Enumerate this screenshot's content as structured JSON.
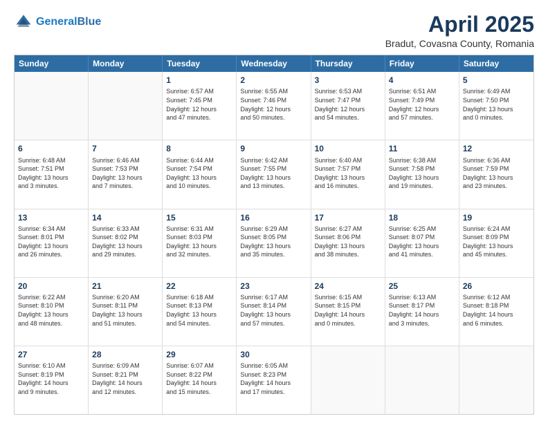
{
  "header": {
    "logo_line1": "General",
    "logo_line2": "Blue",
    "title": "April 2025",
    "subtitle": "Bradut, Covasna County, Romania"
  },
  "days": [
    "Sunday",
    "Monday",
    "Tuesday",
    "Wednesday",
    "Thursday",
    "Friday",
    "Saturday"
  ],
  "rows": [
    [
      {
        "day": "",
        "lines": []
      },
      {
        "day": "",
        "lines": []
      },
      {
        "day": "1",
        "lines": [
          "Sunrise: 6:57 AM",
          "Sunset: 7:45 PM",
          "Daylight: 12 hours",
          "and 47 minutes."
        ]
      },
      {
        "day": "2",
        "lines": [
          "Sunrise: 6:55 AM",
          "Sunset: 7:46 PM",
          "Daylight: 12 hours",
          "and 50 minutes."
        ]
      },
      {
        "day": "3",
        "lines": [
          "Sunrise: 6:53 AM",
          "Sunset: 7:47 PM",
          "Daylight: 12 hours",
          "and 54 minutes."
        ]
      },
      {
        "day": "4",
        "lines": [
          "Sunrise: 6:51 AM",
          "Sunset: 7:49 PM",
          "Daylight: 12 hours",
          "and 57 minutes."
        ]
      },
      {
        "day": "5",
        "lines": [
          "Sunrise: 6:49 AM",
          "Sunset: 7:50 PM",
          "Daylight: 13 hours",
          "and 0 minutes."
        ]
      }
    ],
    [
      {
        "day": "6",
        "lines": [
          "Sunrise: 6:48 AM",
          "Sunset: 7:51 PM",
          "Daylight: 13 hours",
          "and 3 minutes."
        ]
      },
      {
        "day": "7",
        "lines": [
          "Sunrise: 6:46 AM",
          "Sunset: 7:53 PM",
          "Daylight: 13 hours",
          "and 7 minutes."
        ]
      },
      {
        "day": "8",
        "lines": [
          "Sunrise: 6:44 AM",
          "Sunset: 7:54 PM",
          "Daylight: 13 hours",
          "and 10 minutes."
        ]
      },
      {
        "day": "9",
        "lines": [
          "Sunrise: 6:42 AM",
          "Sunset: 7:55 PM",
          "Daylight: 13 hours",
          "and 13 minutes."
        ]
      },
      {
        "day": "10",
        "lines": [
          "Sunrise: 6:40 AM",
          "Sunset: 7:57 PM",
          "Daylight: 13 hours",
          "and 16 minutes."
        ]
      },
      {
        "day": "11",
        "lines": [
          "Sunrise: 6:38 AM",
          "Sunset: 7:58 PM",
          "Daylight: 13 hours",
          "and 19 minutes."
        ]
      },
      {
        "day": "12",
        "lines": [
          "Sunrise: 6:36 AM",
          "Sunset: 7:59 PM",
          "Daylight: 13 hours",
          "and 23 minutes."
        ]
      }
    ],
    [
      {
        "day": "13",
        "lines": [
          "Sunrise: 6:34 AM",
          "Sunset: 8:01 PM",
          "Daylight: 13 hours",
          "and 26 minutes."
        ]
      },
      {
        "day": "14",
        "lines": [
          "Sunrise: 6:33 AM",
          "Sunset: 8:02 PM",
          "Daylight: 13 hours",
          "and 29 minutes."
        ]
      },
      {
        "day": "15",
        "lines": [
          "Sunrise: 6:31 AM",
          "Sunset: 8:03 PM",
          "Daylight: 13 hours",
          "and 32 minutes."
        ]
      },
      {
        "day": "16",
        "lines": [
          "Sunrise: 6:29 AM",
          "Sunset: 8:05 PM",
          "Daylight: 13 hours",
          "and 35 minutes."
        ]
      },
      {
        "day": "17",
        "lines": [
          "Sunrise: 6:27 AM",
          "Sunset: 8:06 PM",
          "Daylight: 13 hours",
          "and 38 minutes."
        ]
      },
      {
        "day": "18",
        "lines": [
          "Sunrise: 6:25 AM",
          "Sunset: 8:07 PM",
          "Daylight: 13 hours",
          "and 41 minutes."
        ]
      },
      {
        "day": "19",
        "lines": [
          "Sunrise: 6:24 AM",
          "Sunset: 8:09 PM",
          "Daylight: 13 hours",
          "and 45 minutes."
        ]
      }
    ],
    [
      {
        "day": "20",
        "lines": [
          "Sunrise: 6:22 AM",
          "Sunset: 8:10 PM",
          "Daylight: 13 hours",
          "and 48 minutes."
        ]
      },
      {
        "day": "21",
        "lines": [
          "Sunrise: 6:20 AM",
          "Sunset: 8:11 PM",
          "Daylight: 13 hours",
          "and 51 minutes."
        ]
      },
      {
        "day": "22",
        "lines": [
          "Sunrise: 6:18 AM",
          "Sunset: 8:13 PM",
          "Daylight: 13 hours",
          "and 54 minutes."
        ]
      },
      {
        "day": "23",
        "lines": [
          "Sunrise: 6:17 AM",
          "Sunset: 8:14 PM",
          "Daylight: 13 hours",
          "and 57 minutes."
        ]
      },
      {
        "day": "24",
        "lines": [
          "Sunrise: 6:15 AM",
          "Sunset: 8:15 PM",
          "Daylight: 14 hours",
          "and 0 minutes."
        ]
      },
      {
        "day": "25",
        "lines": [
          "Sunrise: 6:13 AM",
          "Sunset: 8:17 PM",
          "Daylight: 14 hours",
          "and 3 minutes."
        ]
      },
      {
        "day": "26",
        "lines": [
          "Sunrise: 6:12 AM",
          "Sunset: 8:18 PM",
          "Daylight: 14 hours",
          "and 6 minutes."
        ]
      }
    ],
    [
      {
        "day": "27",
        "lines": [
          "Sunrise: 6:10 AM",
          "Sunset: 8:19 PM",
          "Daylight: 14 hours",
          "and 9 minutes."
        ]
      },
      {
        "day": "28",
        "lines": [
          "Sunrise: 6:09 AM",
          "Sunset: 8:21 PM",
          "Daylight: 14 hours",
          "and 12 minutes."
        ]
      },
      {
        "day": "29",
        "lines": [
          "Sunrise: 6:07 AM",
          "Sunset: 8:22 PM",
          "Daylight: 14 hours",
          "and 15 minutes."
        ]
      },
      {
        "day": "30",
        "lines": [
          "Sunrise: 6:05 AM",
          "Sunset: 8:23 PM",
          "Daylight: 14 hours",
          "and 17 minutes."
        ]
      },
      {
        "day": "",
        "lines": []
      },
      {
        "day": "",
        "lines": []
      },
      {
        "day": "",
        "lines": []
      }
    ]
  ]
}
